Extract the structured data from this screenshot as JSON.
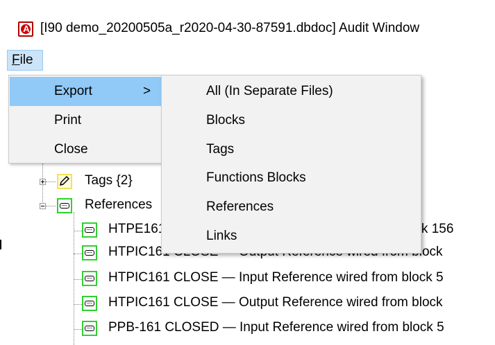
{
  "window": {
    "title": "[I90 demo_20200505a_r2020-04-30-87591.dbdoc] Audit Window",
    "icon": "app-icon"
  },
  "menubar": {
    "file_label_underlined": "F",
    "file_label_rest": "ile"
  },
  "file_menu": {
    "items": [
      {
        "label": "Export",
        "arrow": ">"
      },
      {
        "label": "Print"
      },
      {
        "label": "Close"
      }
    ]
  },
  "export_submenu": {
    "items": [
      {
        "label": "All (In Separate Files)"
      },
      {
        "label": "Blocks"
      },
      {
        "label": "Tags"
      },
      {
        "label": "Functions Blocks"
      },
      {
        "label": "References"
      },
      {
        "label": "Links"
      }
    ]
  },
  "tree": {
    "nodes": [
      {
        "label": "Tags {2}"
      },
      {
        "label": "References"
      },
      {
        "label": "HTPE161 CLOSE — Input Reference wired from block 156"
      },
      {
        "label": "HTPIC161 CLOSE — Output Reference wired from block"
      },
      {
        "label": "HTPIC161 CLOSE — Input Reference wired from block 5"
      },
      {
        "label": "HTPIC161 CLOSE — Output Reference wired from block"
      },
      {
        "label": "PPB-161 CLOSED — Input Reference wired from block 5"
      }
    ]
  },
  "colors": {
    "menu_highlight": "#91c9f7",
    "file_menu_selected": "#cce4f7",
    "reference_icon_border": "#2ed12e",
    "tag_icon_border": "#f5e05a"
  }
}
